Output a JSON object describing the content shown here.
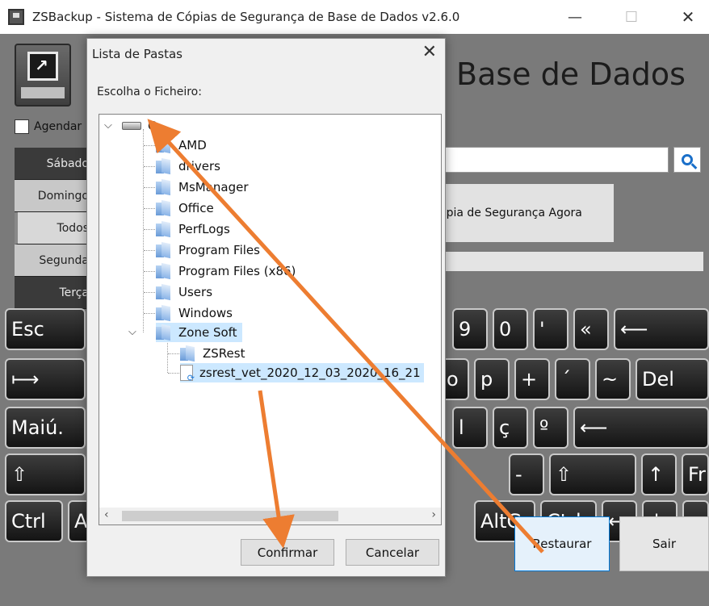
{
  "window": {
    "title": "ZSBackup - Sistema de Cópias de Segurança de Base de Dados v2.6.0",
    "min": "—",
    "max": "☐",
    "close": "✕"
  },
  "main": {
    "big_title": "Base de Dados",
    "agendar_label": "Agendar",
    "days": [
      "Sábado",
      "Domingo",
      "Todos",
      "Segunda",
      "Terça"
    ],
    "backup_now": "ópia de Segurança Agora"
  },
  "keyboard": {
    "row1": [
      "Esc",
      "9",
      "0",
      "'",
      "«",
      "⟵"
    ],
    "row2": [
      "⟼",
      "o",
      "p",
      "+",
      "´",
      "~",
      "Del"
    ],
    "row3": [
      "Maiú.",
      "l",
      "ç",
      "º",
      "⟵"
    ],
    "row4": [
      "⇧",
      "-",
      "⇧",
      "↑",
      "Fr"
    ],
    "row5": [
      "Ctrl",
      "A",
      "AltGr",
      "Ctrl",
      "←",
      "↓",
      "→"
    ]
  },
  "buttons": {
    "restaurar": "Restaurar",
    "sair": "Sair"
  },
  "dialog": {
    "title": "Lista de Pastas",
    "close": "✕",
    "label": "Escolha o Ficheiro:",
    "drive": "C:",
    "folders": [
      "AMD",
      "drivers",
      "MsManager",
      "Office",
      "PerfLogs",
      "Program Files",
      "Program Files (x86)",
      "Users",
      "Windows",
      "Zone Soft"
    ],
    "children": [
      "ZSRest"
    ],
    "file": "zsrest_vet_2020_12_03_2020_16_21",
    "confirm": "Confirmar",
    "cancel": "Cancelar"
  },
  "colors": {
    "arrow": "#ed7d31",
    "selection": "#cce8ff",
    "accent": "#0078d7"
  }
}
